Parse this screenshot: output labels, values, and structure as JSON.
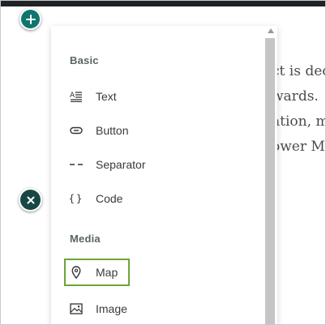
{
  "background": {
    "lines": [
      "ct is dec",
      "wards. ",
      "ation, m",
      "ower M"
    ]
  },
  "menu": {
    "sections": [
      {
        "title": "Basic",
        "items": [
          {
            "label": "Text",
            "icon": "text-icon"
          },
          {
            "label": "Button",
            "icon": "button-icon"
          },
          {
            "label": "Separator",
            "icon": "separator-icon"
          },
          {
            "label": "Code",
            "icon": "code-icon"
          }
        ]
      },
      {
        "title": "Media",
        "items": [
          {
            "label": "Map",
            "icon": "map-pin-icon",
            "selected": true
          },
          {
            "label": "Image",
            "icon": "image-icon"
          }
        ]
      }
    ]
  },
  "colors": {
    "accent": "#0f766e",
    "close_button": "#174743",
    "selection_outline": "#6aa637",
    "top_bar": "#1f2326"
  }
}
